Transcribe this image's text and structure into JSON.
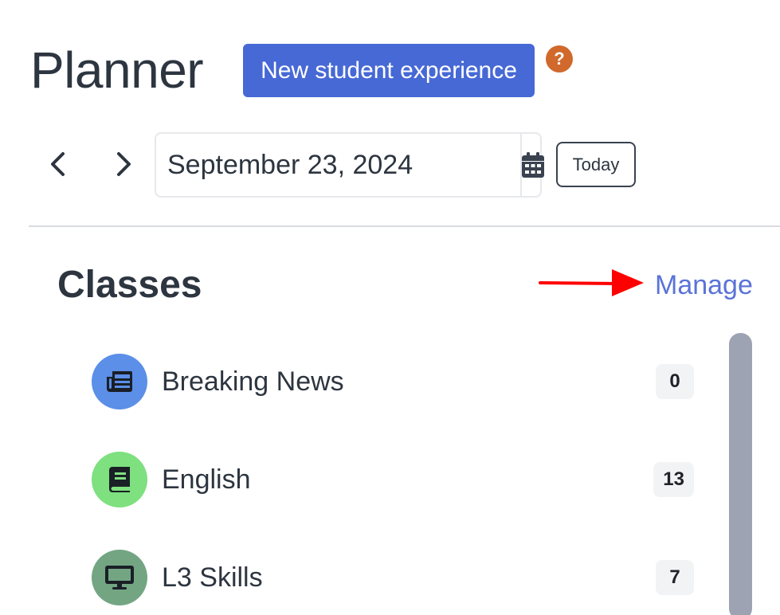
{
  "header": {
    "title": "Planner",
    "new_experience_label": "New student experience",
    "help_symbol": "?"
  },
  "date_nav": {
    "prev_icon": "chevron-left-icon",
    "next_icon": "chevron-right-icon",
    "date_value": "September 23, 2024",
    "calendar_icon": "calendar-icon",
    "today_label": "Today"
  },
  "classes": {
    "title": "Classes",
    "manage_label": "Manage",
    "items": [
      {
        "name": "Breaking News",
        "count": "0",
        "icon": "newspaper-icon",
        "color": "#5b8fe8"
      },
      {
        "name": "English",
        "count": "13",
        "icon": "book-icon",
        "color": "#7ee07f"
      },
      {
        "name": "L3 Skills",
        "count": "7",
        "icon": "monitor-icon",
        "color": "#73a583"
      }
    ]
  },
  "colors": {
    "accent": "#4769d6",
    "help": "#d0692b",
    "link": "#5a73d8",
    "annotation_arrow": "#ff0000",
    "scrollbar": "#9ea3b3"
  }
}
